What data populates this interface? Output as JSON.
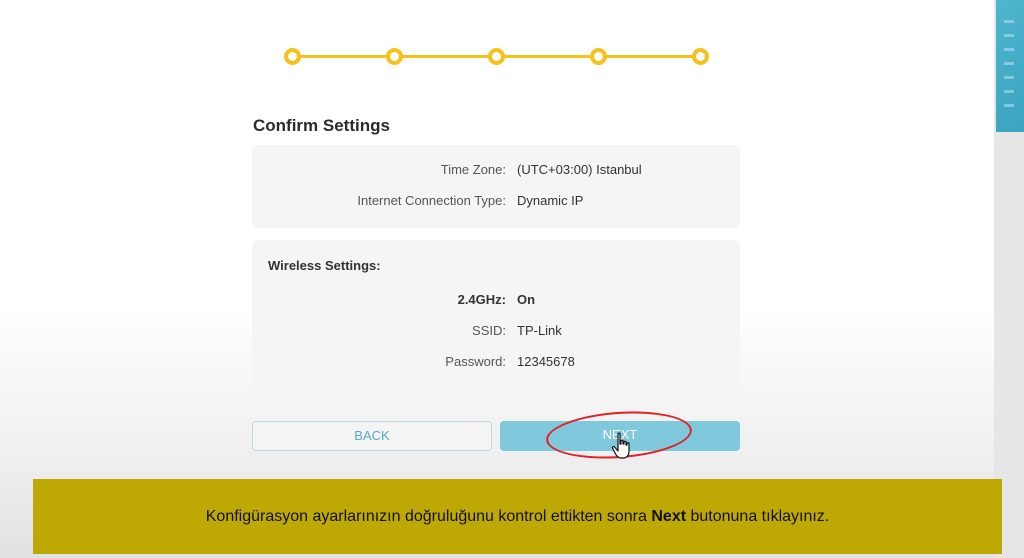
{
  "steps": 5,
  "colors": {
    "accent": "#f4c21a",
    "banner": "#bea804",
    "next_button": "#80c8db",
    "highlight": "#e01f26"
  },
  "card": {
    "title": "Confirm Settings"
  },
  "general": {
    "time_zone_label": "Time Zone:",
    "time_zone_value": "(UTC+03:00) Istanbul",
    "connection_label": "Internet Connection Type:",
    "connection_value": "Dynamic IP"
  },
  "wireless": {
    "section_label": "Wireless Settings:",
    "band_label": "2.4GHz:",
    "band_value": "On",
    "ssid_label": "SSID:",
    "ssid_value": "TP-Link",
    "password_label": "Password:",
    "password_value": "12345678"
  },
  "buttons": {
    "back": "BACK",
    "next": "NEXT"
  },
  "banner": {
    "before": "Konfigürasyon ayarlarınızın doğruluğunu kontrol ettikten sonra ",
    "bold": "Next",
    "after": " butonuna tıklayınız."
  },
  "icons": {
    "cursor": "hand-pointer-icon"
  }
}
